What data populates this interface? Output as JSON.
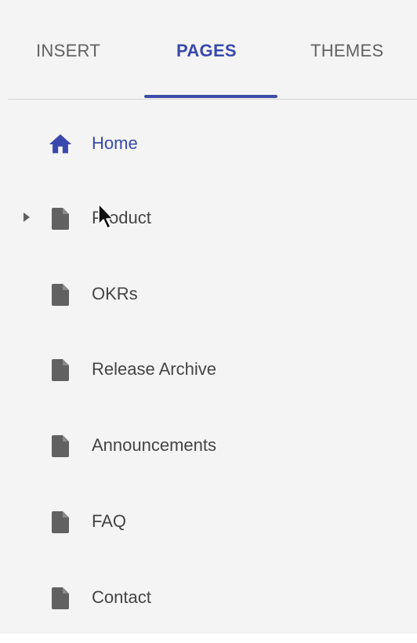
{
  "tabs": {
    "insert": "INSERT",
    "pages": "PAGES",
    "themes": "THEMES",
    "active": "pages"
  },
  "pages": [
    {
      "label": "Home",
      "icon": "home-icon",
      "active": true,
      "expandable": false
    },
    {
      "label": "Product",
      "icon": "document-icon",
      "active": false,
      "expandable": true
    },
    {
      "label": "OKRs",
      "icon": "document-icon",
      "active": false,
      "expandable": false
    },
    {
      "label": "Release Archive",
      "icon": "document-icon",
      "active": false,
      "expandable": false
    },
    {
      "label": "Announcements",
      "icon": "document-icon",
      "active": false,
      "expandable": false
    },
    {
      "label": "FAQ",
      "icon": "document-icon",
      "active": false,
      "expandable": false
    },
    {
      "label": "Contact",
      "icon": "document-icon",
      "active": false,
      "expandable": false
    }
  ],
  "colors": {
    "accent": "#3949ab",
    "tab_inactive": "#616161",
    "text": "#444444",
    "icon": "#616161",
    "background": "#f4f4f4"
  }
}
